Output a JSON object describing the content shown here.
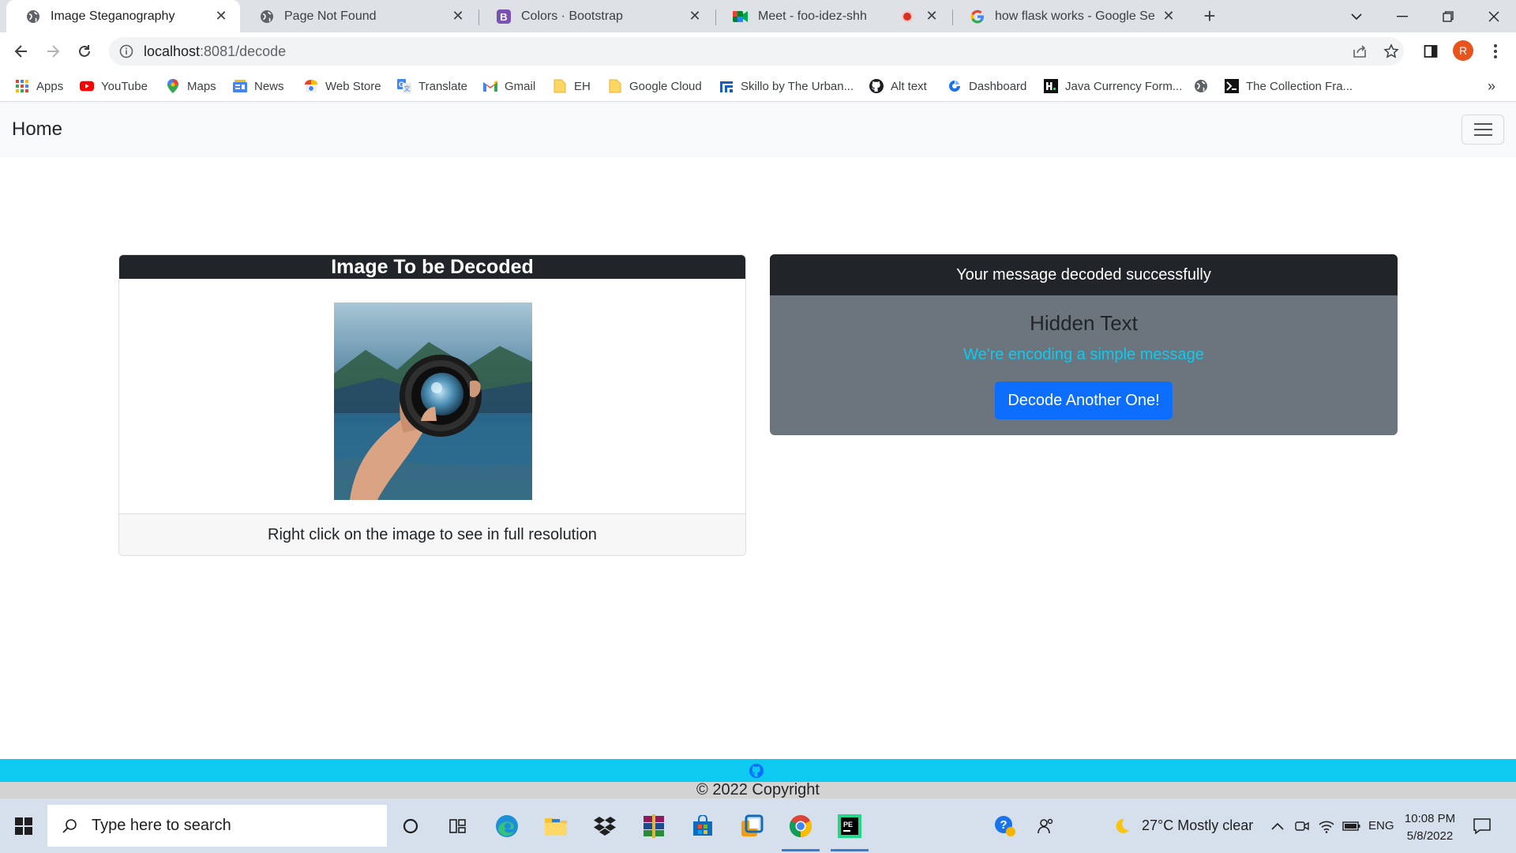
{
  "browser": {
    "tabs": [
      {
        "title": "Image Steganography",
        "icon": "globe-icon",
        "active": true
      },
      {
        "title": "Page Not Found",
        "icon": "globe-icon",
        "active": false
      },
      {
        "title": "Colors · Bootstrap",
        "icon": "bootstrap-icon",
        "active": false
      },
      {
        "title": "Meet - foo-idez-shh",
        "icon": "meet-icon",
        "active": false
      },
      {
        "title": "how flask works - Google Search",
        "icon": "google-icon",
        "active": false
      }
    ],
    "url_host": "localhost",
    "url_path": ":8081/decode",
    "profile_initial": "R",
    "bookmarks": [
      {
        "label": "Apps",
        "icon": "apps-grid-icon"
      },
      {
        "label": "YouTube",
        "icon": "youtube-icon"
      },
      {
        "label": "Maps",
        "icon": "maps-icon"
      },
      {
        "label": "News",
        "icon": "news-icon"
      },
      {
        "label": "Web Store",
        "icon": "webstore-icon"
      },
      {
        "label": "Translate",
        "icon": "translate-icon"
      },
      {
        "label": "Gmail",
        "icon": "gmail-icon"
      },
      {
        "label": "EH",
        "icon": "folder-icon"
      },
      {
        "label": "Google Cloud",
        "icon": "folder-icon"
      },
      {
        "label": "Skillo by The Urban...",
        "icon": "skillo-icon"
      },
      {
        "label": "Alt text",
        "icon": "github-icon"
      },
      {
        "label": "Dashboard",
        "icon": "dashboard-icon"
      },
      {
        "label": "Java Currency Form...",
        "icon": "java-icon"
      },
      {
        "label": "",
        "icon": "globe-icon"
      },
      {
        "label": "The Collection Fra...",
        "icon": "terminal-icon"
      }
    ],
    "more_bookmarks": "»"
  },
  "page": {
    "brand": "Home",
    "image_card": {
      "title": "Image To be Decoded",
      "footer": "Right click on the image to see in full resolution"
    },
    "result_card": {
      "header": "Your message decoded successfully",
      "heading": "Hidden Text",
      "message": "We're encoding a simple message",
      "button": "Decode Another One!"
    },
    "copyright": "© 2022 Copyright"
  },
  "taskbar": {
    "search_placeholder": "Type here to search",
    "weather": "27°C  Mostly clear",
    "language": "ENG",
    "time": "10:08 PM",
    "date": "5/8/2022"
  },
  "colors": {
    "dark": "#212529",
    "secondary": "#6c757d",
    "info": "#0dcaf0",
    "primary": "#0d6efd"
  }
}
